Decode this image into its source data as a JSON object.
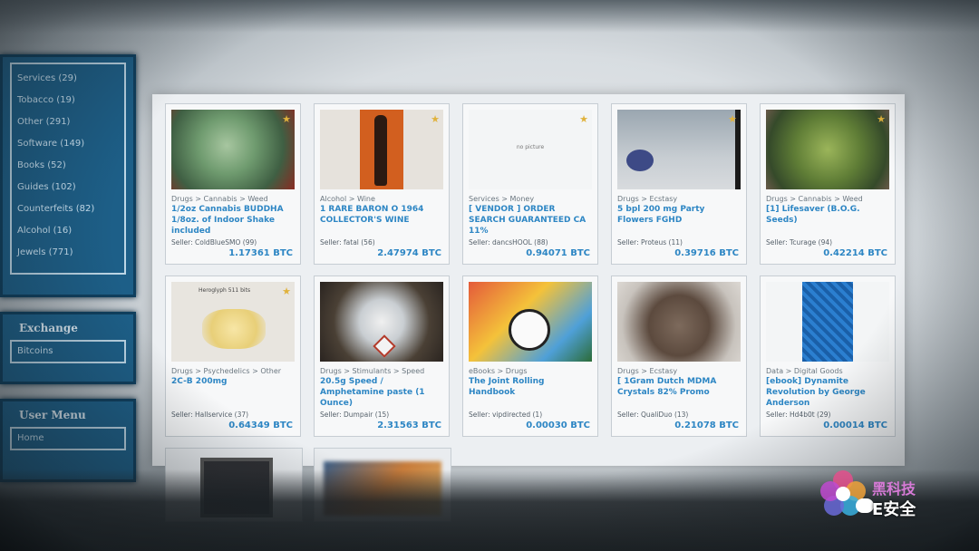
{
  "sidebar": {
    "categories": [
      "Services (29)",
      "Tobacco (19)",
      "Other (291)",
      "Software (149)",
      "Books (52)",
      "Guides (102)",
      "Counterfeits (82)",
      "Alcohol (16)",
      "Jewels (771)"
    ],
    "exchange": {
      "title": "Exchange",
      "field": "Bitcoins"
    },
    "user_menu": {
      "title": "User Menu",
      "field": "Home"
    }
  },
  "listings": [
    {
      "category": "Drugs > Cannabis > Weed",
      "title": "1/2oz Cannabis BUDDHA 1/8oz. of Indoor Shake included",
      "seller": "Seller: ColdBlueSMO (99)",
      "price": "1.17361 BTC",
      "thumb": "weed",
      "thumb_text": ""
    },
    {
      "category": "Alcohol > Wine",
      "title": "1 RARE BARON O 1964 COLLECTOR'S WINE",
      "seller": "Seller: fatal (56)",
      "price": "2.47974 BTC",
      "thumb": "bottle",
      "thumb_text": ""
    },
    {
      "category": "Services > Money",
      "title": "[ VENDOR ] ORDER SEARCH GUARANTEED CA 11%",
      "seller": "Seller: dancsHOOL (88)",
      "price": "0.94071 BTC",
      "thumb": "blank",
      "thumb_text": "no picture"
    },
    {
      "category": "Drugs > Ecstasy",
      "title": "5 bpl 200 mg Party Flowers FGHD",
      "seller": "Seller: Proteus (11)",
      "price": "0.39716 BTC",
      "thumb": "pills",
      "thumb_text": ""
    },
    {
      "category": "Drugs > Cannabis > Weed",
      "title": "[1] Lifesaver (B.O.G. Seeds)",
      "seller": "Seller: Tcurage (94)",
      "price": "0.42214 BTC",
      "thumb": "bud",
      "thumb_text": ""
    },
    {
      "category": "Drugs > Psychedelics > Other",
      "title": "2C-B 200mg",
      "seller": "Seller: Hallservice (37)",
      "price": "0.64349 BTC",
      "thumb": "crystal",
      "thumb_text": "Heroglyph 511 bits"
    },
    {
      "category": "Drugs > Stimulants > Speed",
      "title": "20.5g Speed / Amphetamine paste (1 Ounce)",
      "seller": "Seller: Dumpair (15)",
      "price": "2.31563 BTC",
      "thumb": "powder",
      "thumb_text": ""
    },
    {
      "category": "eBooks > Drugs",
      "title": "The Joint Rolling Handbook",
      "seller": "Seller: vipdirected (1)",
      "price": "0.00030 BTC",
      "thumb": "comic",
      "thumb_text": ""
    },
    {
      "category": "Drugs > Ecstasy",
      "title": "[ 1Gram Dutch MDMA Crystals 82% Promo",
      "seller": "Seller: QualiDuo (13)",
      "price": "0.21078 BTC",
      "thumb": "rocks",
      "thumb_text": ""
    },
    {
      "category": "Data > Digital Goods",
      "title": "[ebook] Dynamite Revolution by George Anderson",
      "seller": "Seller: Hd4b0t (29)",
      "price": "0.00014 BTC",
      "thumb": "book",
      "thumb_text": ""
    }
  ],
  "watermark": {
    "line1": "黑科技",
    "line2": "E安全"
  },
  "colors": {
    "sidebar_bg": "#1d5f88",
    "link_blue": "#2d86c4",
    "badge": "#e0b23c"
  }
}
